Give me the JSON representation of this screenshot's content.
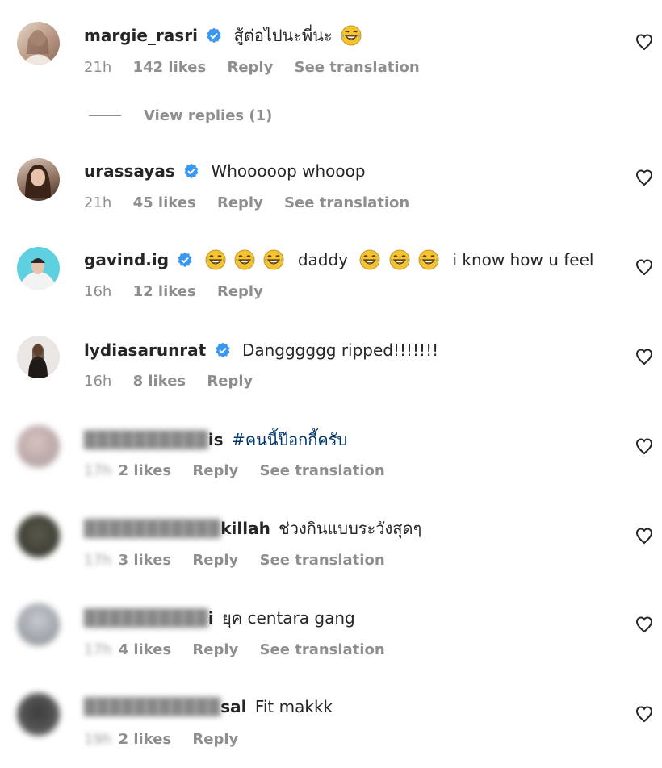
{
  "comments": [
    {
      "username": "margie_rasri",
      "verified": true,
      "text": "สู้ต่อไปนะพี่นะ",
      "emoji_before": 0,
      "emoji_after": 1,
      "time": "21h",
      "likes": "142 likes",
      "reply": "Reply",
      "translate": "See translation",
      "username_blurred": false
    },
    {
      "username": "urassayas",
      "verified": true,
      "text": "Whooooop whooop",
      "time": "21h",
      "likes": "45 likes",
      "reply": "Reply",
      "translate": "See translation",
      "username_blurred": false
    },
    {
      "username": "gavind.ig",
      "verified": true,
      "text_middle": "daddy",
      "text_end": "i know how u feel",
      "time": "16h",
      "likes": "12 likes",
      "reply": "Reply",
      "username_blurred": false
    },
    {
      "username": "lydiasarunrat",
      "verified": true,
      "text": "Dangggggg ripped!!!!!!!",
      "time": "16h",
      "likes": "8 likes",
      "reply": "Reply",
      "username_blurred": false
    },
    {
      "username_tail": "is",
      "text": "#คนนี้ป๊อกกี้ครับ",
      "time": "",
      "likes": "2 likes",
      "reply": "Reply",
      "translate": "See translation",
      "username_blurred": true
    },
    {
      "username_tail": "killah",
      "text": "ช่วงกินแบบระวังสุดๆ",
      "time": "",
      "likes": "3 likes",
      "reply": "Reply",
      "translate": "See translation",
      "username_blurred": true
    },
    {
      "username_tail": "i",
      "text": "ยุค centara gang",
      "time": "",
      "likes": "4 likes",
      "reply": "Reply",
      "translate": "See translation",
      "username_blurred": true
    },
    {
      "username_tail": "sal",
      "text": "Fit makkk",
      "time": "19h",
      "likes": "2 likes",
      "reply": "Reply",
      "username_blurred": true
    }
  ],
  "view_replies": "View replies (1)",
  "colors": {
    "verified": "#3897f0",
    "meta": "#8e8e8e",
    "hashtag": "#00376b",
    "emoji": "#f4c430"
  }
}
